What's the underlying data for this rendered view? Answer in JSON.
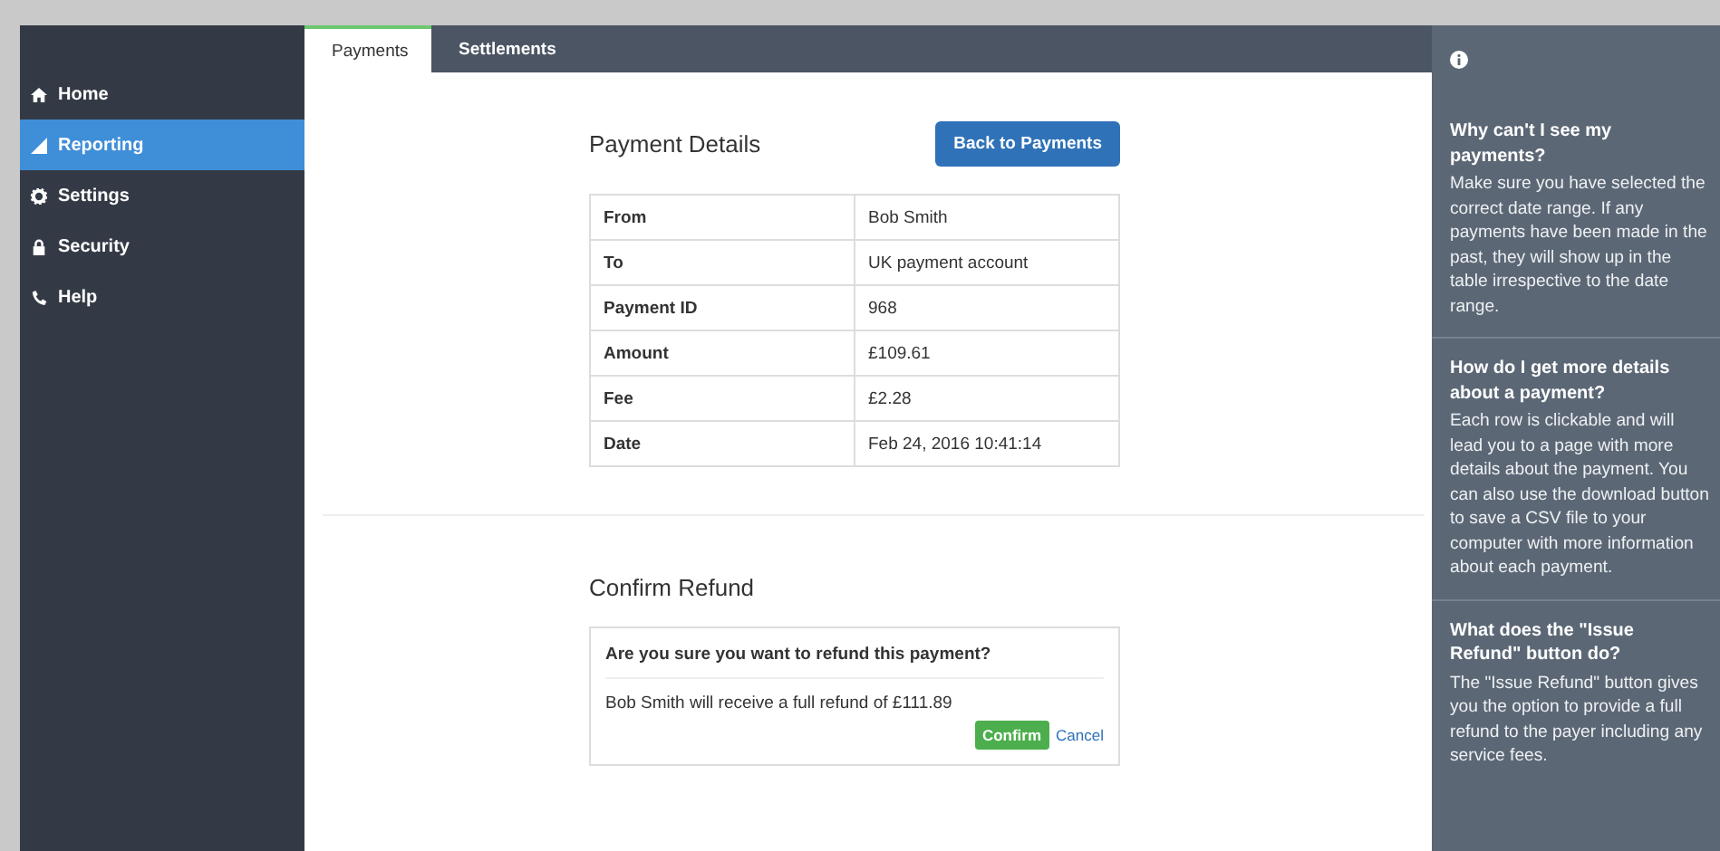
{
  "sidebar": {
    "items": [
      {
        "label": "Home",
        "selected": false
      },
      {
        "label": "Reporting",
        "selected": true
      },
      {
        "label": "Settings",
        "selected": false
      },
      {
        "label": "Security",
        "selected": false
      },
      {
        "label": "Help",
        "selected": false
      }
    ]
  },
  "tabs": [
    {
      "label": "Payments",
      "selected": true
    },
    {
      "label": "Settlements",
      "selected": false
    }
  ],
  "details": {
    "title": "Payment Details",
    "back_button": "Back to Payments",
    "rows": [
      {
        "label": "From",
        "value": "Bob Smith"
      },
      {
        "label": "To",
        "value": "UK payment account"
      },
      {
        "label": "Payment ID",
        "value": "968"
      },
      {
        "label": "Amount",
        "value": "£109.61"
      },
      {
        "label": "Fee",
        "value": "£2.28"
      },
      {
        "label": "Date",
        "value": "Feb 24, 2016 10:41:14"
      }
    ]
  },
  "refund": {
    "title": "Confirm Refund",
    "question": "Are you sure you want to refund this payment?",
    "message": "Bob Smith will receive a full refund of £111.89",
    "confirm_button": "Confirm",
    "cancel_link": "Cancel"
  },
  "help_panel": {
    "sections": [
      {
        "question": "Why can't I see my payments?",
        "answer": "Make sure you have selected the correct date range. If any payments have been made in the past, they will show up in the table irrespective to the date range."
      },
      {
        "question": "How do I get more details about a payment?",
        "answer": "Each row is clickable and will lead you to a page with more details about the payment. You can also use the download button to save a CSV file to your computer with more information about each payment."
      },
      {
        "question": "What does the \"Issue Refund\" button do?",
        "answer": "The \"Issue Refund\" button gives you the option to provide a full refund to the payer including any service fees."
      }
    ]
  }
}
